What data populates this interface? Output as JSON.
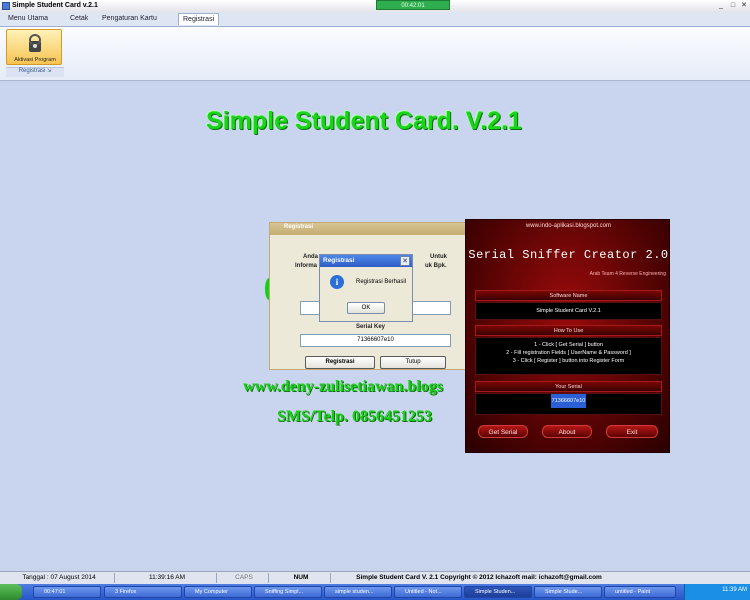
{
  "window": {
    "title": "Simple Student Card v.2.1",
    "clock": "00:42:01",
    "controls": {
      "min": "_",
      "max": "□",
      "close": "✕"
    }
  },
  "ribbon": {
    "tabs": [
      {
        "label": "Menu Utama",
        "active": false
      },
      {
        "label": "Cetak",
        "active": false
      },
      {
        "label": "Pengaturan Kartu",
        "active": false
      },
      {
        "label": "Registrasi",
        "active": true
      }
    ],
    "aktivasi_label": "Aktivasi Program",
    "group_label": "Registrasi",
    "group_icon": "dialog-launcher-icon"
  },
  "main": {
    "title": "Simple Student Card. V.2.1",
    "website": "www.deny-zulisetiawan.blogs",
    "sms": "SMS/Telp. 0856451253"
  },
  "reg_dialog": {
    "title": "Registrasi",
    "text_left_1": "Anda",
    "text_left_2": "Informa",
    "text_right_1": "Untuk",
    "text_right_2": "uk Bpk.",
    "serial_label": "Serial Key",
    "serial_value": "71366607e10",
    "registrasi_button": "Registrasi",
    "tutup_button": "Tutup"
  },
  "message_box": {
    "title": "Registrasi",
    "message": "Registrasi Berhasil",
    "ok": "OK",
    "icon": "info-icon",
    "close": "✕"
  },
  "sniffer": {
    "site": "www.indo-aplikasi.blogspot.com",
    "name": "Serial Sniffer Creator 2.0",
    "team": "Arab Team 4 Reverse Engineering",
    "software_name_label": "Software Name",
    "software_name_value": "Simple Student Card V.2.1",
    "how_to_label": "How To Use",
    "how_to_steps": [
      "1 - Click [ Get Serial ] button",
      "2 - Fill registration Fields [ UserName & Password ]",
      "3 - Click [ Register ] button into Register Form"
    ],
    "your_serial_label": "Your Serial",
    "your_serial_value": "71366607e10",
    "get_serial": "Get Serial",
    "about": "About",
    "exit": "Exit"
  },
  "statusbar": {
    "date": "Tanggal : 07 August 2014",
    "time": "11:39:16 AM",
    "caps": "CAPS",
    "num": "NUM",
    "copyright": "Simple Student Card V. 2.1 Copyright © 2012 Ichazoft mail: ichazoft@gmail.com"
  },
  "taskbar": {
    "start_icon": "windows-start-icon",
    "items": [
      {
        "label": "00:47:01"
      },
      {
        "label": "3 Firefox"
      },
      {
        "label": "My Computer"
      },
      {
        "label": "Sniffing Simpl..."
      },
      {
        "label": "simple studen..."
      },
      {
        "label": "Untitled - Not..."
      },
      {
        "label": "Simple Studen...",
        "active": true
      },
      {
        "label": "Simple Stude..."
      },
      {
        "label": "untitled - Paint"
      }
    ],
    "clock": "11:39 AM"
  },
  "colors": {
    "accent_green": "#19d51a",
    "sniffer_red": "#9a0b0b",
    "taskbar_blue": "#2756c8"
  }
}
